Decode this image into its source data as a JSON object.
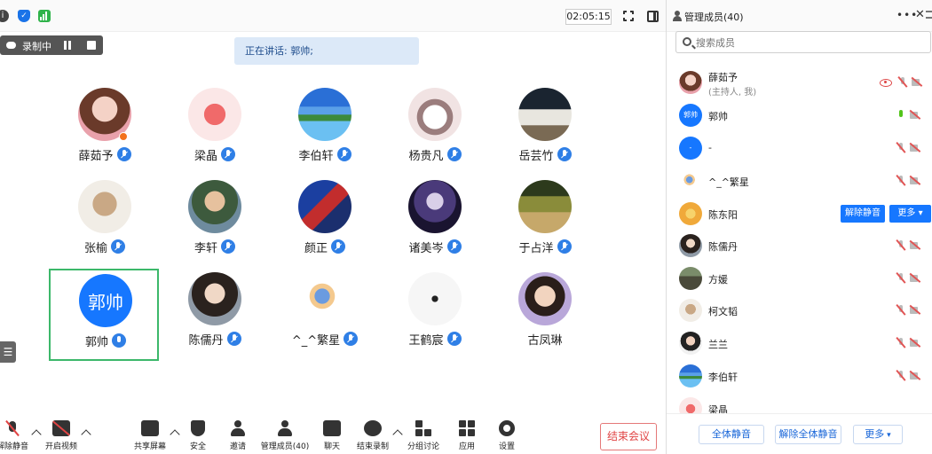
{
  "topbar": {
    "timer": "02:05:15"
  },
  "recording": {
    "label": "录制中"
  },
  "speaking": "正在讲话: 郭帅;",
  "participants": [
    {
      "name": "薛茹予"
    },
    {
      "name": "梁晶"
    },
    {
      "name": "李伯轩"
    },
    {
      "name": "杨贵凡"
    },
    {
      "name": "岳芸竹"
    },
    {
      "name": "张榆"
    },
    {
      "name": "李轩"
    },
    {
      "name": "颜正"
    },
    {
      "name": "诸美岑"
    },
    {
      "name": "于占洋"
    },
    {
      "name": "郭帅",
      "avatar_text": "郭帅"
    },
    {
      "name": "陈儒丹"
    },
    {
      "name": "^_^繁星"
    },
    {
      "name": "王鹤宸"
    },
    {
      "name": "古凤琳"
    }
  ],
  "toolbar": {
    "items": [
      {
        "label": "解除静音",
        "icon": "mic-off-icon"
      },
      {
        "label": "开启视频",
        "icon": "camera-off-icon"
      },
      {
        "label": "共享屏幕",
        "icon": "share-screen-icon"
      },
      {
        "label": "安全",
        "icon": "shield-icon"
      },
      {
        "label": "邀请",
        "icon": "invite-icon"
      },
      {
        "label": "管理成员(40)",
        "icon": "members-icon"
      },
      {
        "label": "聊天",
        "icon": "chat-icon"
      },
      {
        "label": "结束录制",
        "icon": "stop-record-icon"
      },
      {
        "label": "分组讨论",
        "icon": "breakout-icon"
      },
      {
        "label": "应用",
        "icon": "apps-icon"
      },
      {
        "label": "设置",
        "icon": "gear-icon"
      }
    ],
    "end_meeting": "结束会议"
  },
  "panel": {
    "title": "管理成员(40)",
    "search_placeholder": "搜索成员",
    "members": [
      {
        "name": "薛茹予",
        "sub": "(主持人, 我)"
      },
      {
        "name": "郭帅",
        "avatar_text": "郭帅"
      },
      {
        "name": "-",
        "avatar_text": "-"
      },
      {
        "name": "^_^繁星"
      },
      {
        "name": "陈东阳",
        "actions": [
          "解除静音",
          "更多 ▾"
        ]
      },
      {
        "name": "陈儒丹"
      },
      {
        "name": "方媛"
      },
      {
        "name": "柯文韬"
      },
      {
        "name": "兰兰"
      },
      {
        "name": "李伯轩"
      },
      {
        "name": "梁晶"
      }
    ],
    "footer": {
      "mute_all": "全体静音",
      "unmute_all": "解除全体静音",
      "more": "更多"
    }
  }
}
